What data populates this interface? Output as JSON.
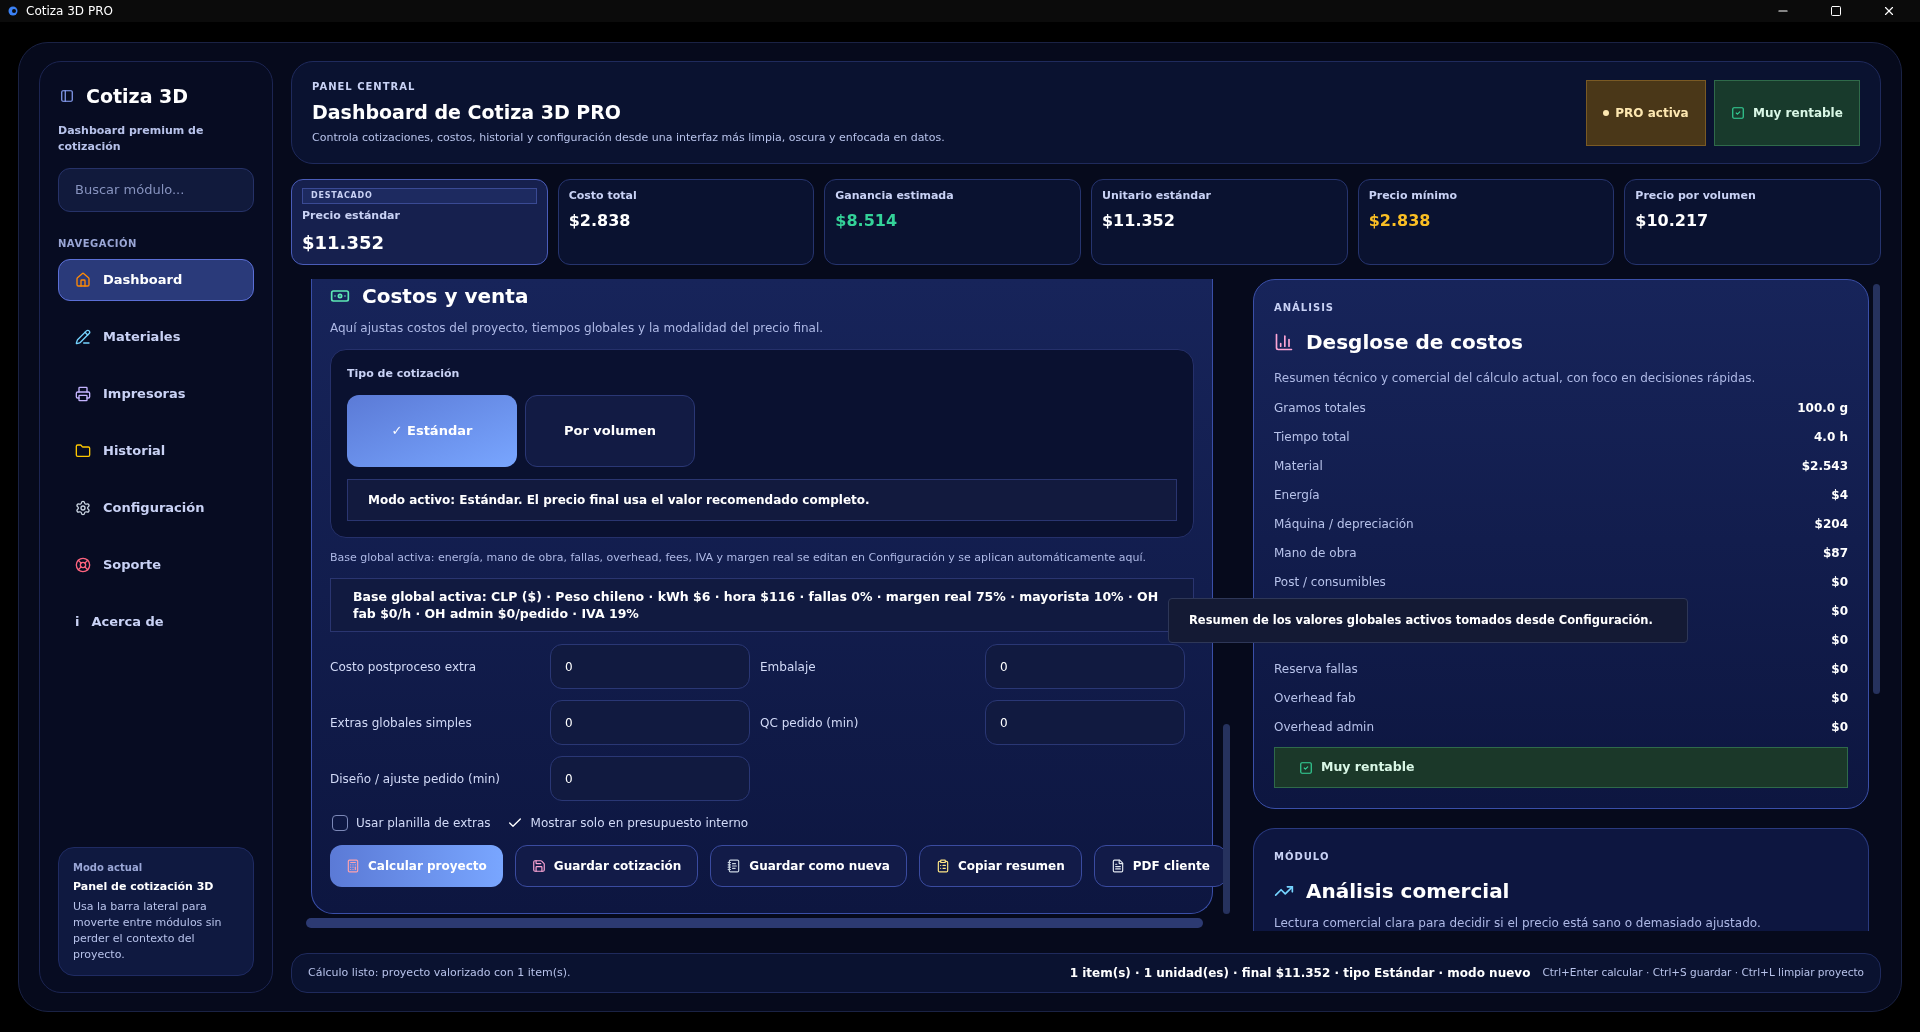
{
  "window": {
    "title": "Cotiza 3D PRO"
  },
  "sidebar": {
    "title": "Cotiza 3D",
    "subtitle": "Dashboard premium de cotización",
    "search": {
      "placeholder": "Buscar módulo..."
    },
    "section_label": "NAVEGACIÓN",
    "items": [
      {
        "label": "Dashboard",
        "kind": "house",
        "selected": true
      },
      {
        "label": "Materiales",
        "kind": "pencil",
        "selected": false
      },
      {
        "label": "Impresoras",
        "kind": "printer",
        "selected": false
      },
      {
        "label": "Historial",
        "kind": "folder",
        "selected": false
      },
      {
        "label": "Configuración",
        "kind": "gear",
        "selected": false
      },
      {
        "label": "Soporte",
        "kind": "lifebuoy",
        "selected": false
      },
      {
        "label": "Acerca de",
        "kind": "text",
        "glyph": "i",
        "selected": false
      }
    ],
    "mode_card": {
      "label": "Modo actual",
      "title": "Panel de cotización 3D",
      "text": "Usa la barra lateral para moverte entre módulos sin perder el contexto del proyecto."
    }
  },
  "header": {
    "eyebrow": "PANEL CENTRAL",
    "title": "Dashboard de Cotiza 3D PRO",
    "subtitle": "Controla cotizaciones, costos, historial y configuración desde una interfaz más limpia, oscura y enfocada en datos.",
    "badges": [
      {
        "label": "PRO activa",
        "kind": "dot"
      },
      {
        "label": "Muy rentable",
        "kind": "check"
      }
    ]
  },
  "stats": [
    {
      "label": "Precio estándar",
      "value": "$11.352",
      "tag": "DESTACADO",
      "featured": true,
      "color": "#ffffff"
    },
    {
      "label": "Costo total",
      "value": "$2.838",
      "featured": false,
      "color": "#ffffff"
    },
    {
      "label": "Ganancia estimada",
      "value": "$8.514",
      "featured": false,
      "color": "#34d399"
    },
    {
      "label": "Unitario estándar",
      "value": "$11.352",
      "featured": false,
      "color": "#ffffff"
    },
    {
      "label": "Precio mínimo",
      "value": "$2.838",
      "featured": false,
      "color": "#fbbf24"
    },
    {
      "label": "Precio por volumen",
      "value": "$10.217",
      "featured": false,
      "color": "#ffffff"
    }
  ],
  "costs_panel": {
    "title": "Costos y venta",
    "subtitle": "Aquí ajustas costos del proyecto, tiempos globales y la modalidad del precio final.",
    "quote_type": {
      "label": "Tipo de cotización",
      "options": [
        {
          "label": "✓ Estándar",
          "selected": true
        },
        {
          "label": "Por volumen",
          "selected": false
        }
      ],
      "active_mode": "Modo activo: Estándar. El precio final usa el valor recomendado completo."
    },
    "global_note": "Base global activa: energía, mano de obra, fallas, overhead, fees, IVA y margen real se editan en Configuración y se aplican automáticamente aquí.",
    "global_summary": "Base global activa: CLP ($) · Peso chileno · kWh $6 · hora $116 · fallas 0% · margen real 75% · mayorista 10% · OH fab $0/h · OH admin $0/pedido · IVA 19%",
    "fields": [
      {
        "label": "Costo postproceso extra",
        "value": "0"
      },
      {
        "label": "Embalaje",
        "value": "0"
      },
      {
        "label": "Extras globales simples",
        "value": "0"
      },
      {
        "label": "QC pedido (min)",
        "value": "0"
      },
      {
        "label": "Diseño / ajuste pedido (min)",
        "value": "0"
      }
    ],
    "options": [
      {
        "label": "Usar planilla de extras",
        "checked": false
      },
      {
        "label": "Mostrar solo en presupuesto interno",
        "checked": true
      }
    ],
    "buttons": [
      {
        "label": "Calcular proyecto",
        "kind": "calculator",
        "primary": true
      },
      {
        "label": "Guardar cotización",
        "kind": "save",
        "primary": false
      },
      {
        "label": "Guardar como nueva",
        "kind": "notebook",
        "primary": false
      },
      {
        "label": "Copiar resumen",
        "kind": "clipboard",
        "primary": false
      },
      {
        "label": "PDF cliente",
        "kind": "file",
        "primary": false
      }
    ]
  },
  "breakdown": {
    "eyebrow": "ANÁLISIS",
    "title": "Desglose de costos",
    "subtitle": "Resumen técnico y comercial del cálculo actual, con foco en decisiones rápidas.",
    "rows": [
      {
        "label": "Gramos totales",
        "value": "100.0 g"
      },
      {
        "label": "Tiempo total",
        "value": "4.0 h"
      },
      {
        "label": "Material",
        "value": "$2.543"
      },
      {
        "label": "Energía",
        "value": "$4"
      },
      {
        "label": "Máquina / depreciación",
        "value": "$204"
      },
      {
        "label": "Mano de obra",
        "value": "$87"
      },
      {
        "label": "Post / consumibles",
        "value": "$0"
      },
      {
        "value": "$0"
      },
      {
        "value": "$0"
      },
      {
        "label": "Reserva fallas",
        "value": "$0"
      },
      {
        "label": "Overhead fab",
        "value": "$0"
      },
      {
        "label": "Overhead admin",
        "value": "$0"
      }
    ],
    "verdict": "Muy rentable"
  },
  "tooltip": "Resumen de los valores globales activos tomados desde Configuración.",
  "commercial": {
    "eyebrow": "MÓDULO",
    "title": "Análisis comercial",
    "subtitle": "Lectura comercial clara para decidir si el precio está sano o demasiado ajustado."
  },
  "status_bar": {
    "left": "Cálculo listo: proyecto valorizado con 1 item(s).",
    "summary": "1 item(s) · 1 unidad(es) · final $11.352 · tipo Estándar · modo nuevo",
    "shortcuts": "Ctrl+Enter calcular · Ctrl+S guardar · Ctrl+L limpiar proyecto"
  }
}
